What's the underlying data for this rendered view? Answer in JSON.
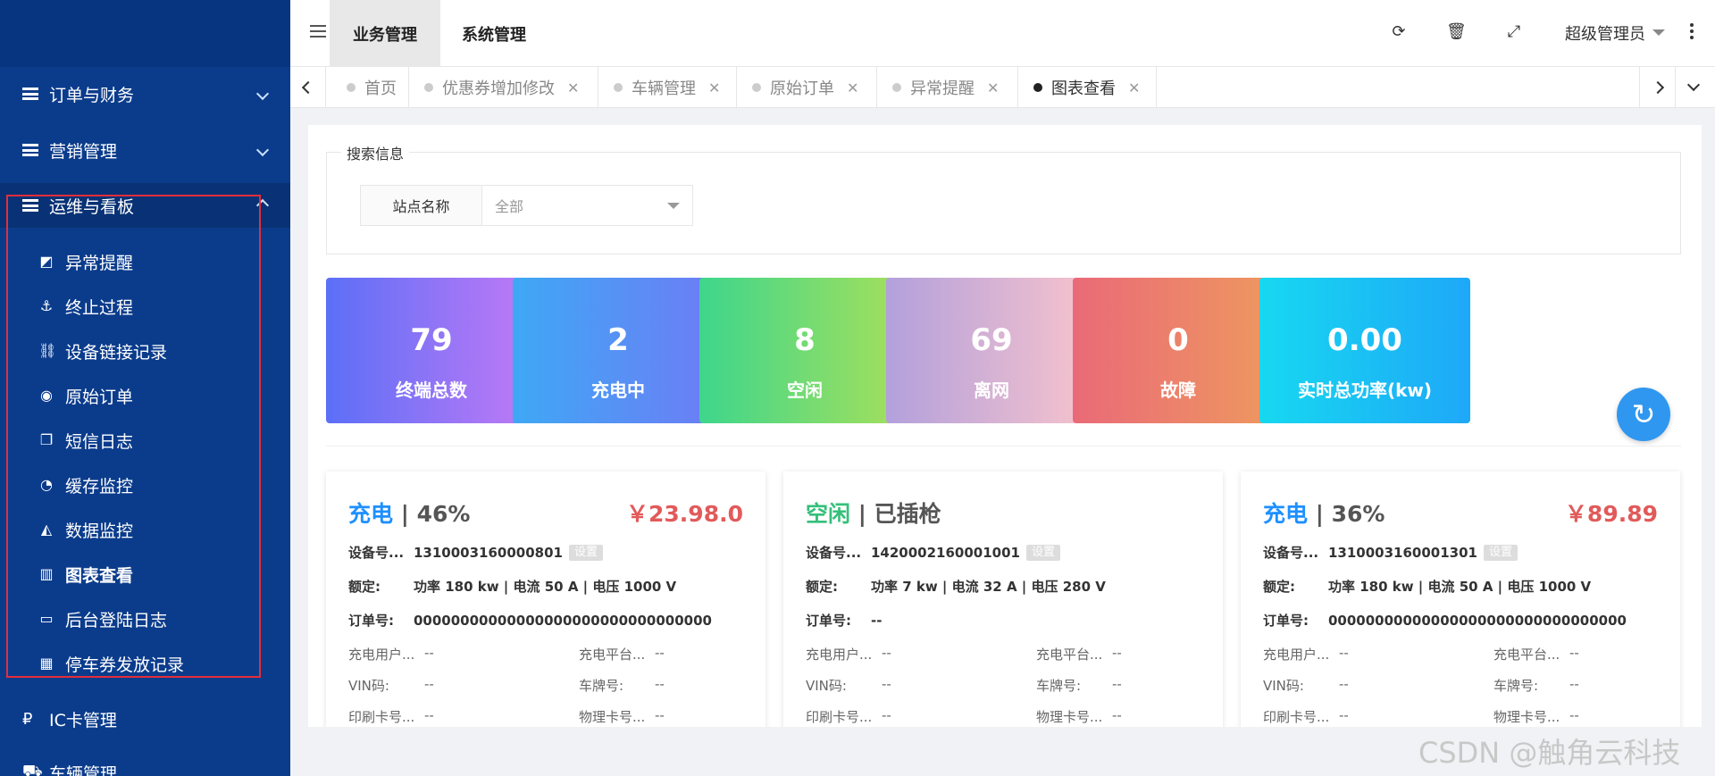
{
  "sidebar": {
    "groups": [
      {
        "label": "订单与财务",
        "expanded": false
      },
      {
        "label": "营销管理",
        "expanded": false
      },
      {
        "label": "运维与看板",
        "expanded": true
      }
    ],
    "sub_items": [
      {
        "label": "异常提醒",
        "icon": "dashboard-icon"
      },
      {
        "label": "终止过程",
        "icon": "anchor-icon"
      },
      {
        "label": "设备链接记录",
        "icon": "link-icon"
      },
      {
        "label": "原始订单",
        "icon": "compass-icon"
      },
      {
        "label": "短信日志",
        "icon": "copy-icon"
      },
      {
        "label": "缓存监控",
        "icon": "feed-icon"
      },
      {
        "label": "数据监控",
        "icon": "area-chart-icon"
      },
      {
        "label": "图表查看",
        "icon": "bar-chart-icon",
        "selected": true
      },
      {
        "label": "后台登陆日志",
        "icon": "desktop-icon"
      },
      {
        "label": "停车券发放记录",
        "icon": "grid-icon"
      }
    ],
    "bottom_items": [
      {
        "label": "IC卡管理",
        "icon": "ruble-icon"
      },
      {
        "label": "车辆管理",
        "icon": "car-icon"
      }
    ]
  },
  "topbar": {
    "nav": [
      "业务管理",
      "系统管理"
    ],
    "active_nav": "业务管理",
    "user": "超级管理员",
    "icons": [
      "refresh-icon",
      "trash-icon",
      "fullscreen-icon",
      "more-icon"
    ]
  },
  "tabs": [
    {
      "label": "首页",
      "closable": false
    },
    {
      "label": "优惠券增加修改",
      "closable": true
    },
    {
      "label": "车辆管理",
      "closable": true
    },
    {
      "label": "原始订单",
      "closable": true
    },
    {
      "label": "异常提醒",
      "closable": true
    },
    {
      "label": "图表查看",
      "closable": true,
      "active": true
    }
  ],
  "search": {
    "legend": "搜索信息",
    "site_label": "站点名称",
    "site_value": "全部"
  },
  "stats": [
    {
      "value": "79",
      "label": "终端总数",
      "gradient": [
        "#5b6ff7",
        "#c27af5"
      ]
    },
    {
      "value": "2",
      "label": "充电中",
      "gradient": [
        "#3ea8f5",
        "#6f7bf5"
      ]
    },
    {
      "value": "8",
      "label": "空闲",
      "gradient": [
        "#3ed68c",
        "#a8e05a"
      ]
    },
    {
      "value": "69",
      "label": "离网",
      "gradient": [
        "#b3a0dc",
        "#f8c4cc"
      ]
    },
    {
      "value": "0",
      "label": "故障",
      "gradient": [
        "#ea6a78",
        "#ee9a5e"
      ]
    },
    {
      "value": "0.00",
      "label": "实时总功率(kw)",
      "gradient": [
        "#17d8f0",
        "#1ea8f8"
      ]
    }
  ],
  "cards": [
    {
      "status": "充电",
      "status_type": "charging",
      "detail": "46%",
      "price": "￥23.98.0",
      "device_key": "设备号...",
      "device_no": "1310003160000801",
      "set_label": "设置",
      "rated_key": "额定:",
      "rated": "功率 180 kw | 电流 50 A | 电压 1000 V",
      "order_key": "订单号:",
      "order_no": "00000000000000000000000000000000",
      "user_key": "充电用户...",
      "user_val": "--",
      "platform_key": "充电平台...",
      "platform_val": "--",
      "vin_key": "VIN码:",
      "vin_val": "--",
      "plate_key": "车牌号:",
      "plate_val": "--",
      "print_key": "印刷卡号...",
      "print_val": "--",
      "phys_key": "物理卡号...",
      "phys_val": "--"
    },
    {
      "status": "空闲",
      "status_type": "idle",
      "detail": "已插枪",
      "price": "",
      "device_key": "设备号...",
      "device_no": "1420002160001001",
      "set_label": "设置",
      "rated_key": "额定:",
      "rated": "功率 7 kw | 电流 32 A | 电压 280 V",
      "order_key": "订单号:",
      "order_no": "--",
      "user_key": "充电用户...",
      "user_val": "--",
      "platform_key": "充电平台...",
      "platform_val": "--",
      "vin_key": "VIN码:",
      "vin_val": "--",
      "plate_key": "车牌号:",
      "plate_val": "--",
      "print_key": "印刷卡号...",
      "print_val": "--",
      "phys_key": "物理卡号...",
      "phys_val": "--"
    },
    {
      "status": "充电",
      "status_type": "charging",
      "detail": "36%",
      "price": "￥89.89",
      "device_key": "设备号...",
      "device_no": "1310003160001301",
      "set_label": "设置",
      "rated_key": "额定:",
      "rated": "功率 180 kw | 电流 50 A | 电压 1000 V",
      "order_key": "订单号:",
      "order_no": "00000000000000000000000000000000",
      "user_key": "充电用户...",
      "user_val": "--",
      "platform_key": "充电平台...",
      "platform_val": "--",
      "vin_key": "VIN码:",
      "vin_val": "--",
      "plate_key": "车牌号:",
      "plate_val": "--",
      "print_key": "印刷卡号...",
      "print_val": "--",
      "phys_key": "物理卡号...",
      "phys_val": "--"
    }
  ],
  "watermark": "CSDN @触角云科技"
}
